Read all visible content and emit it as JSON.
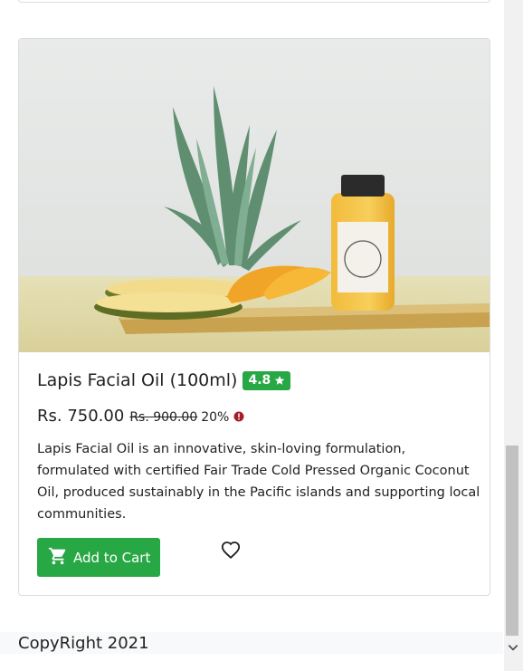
{
  "product": {
    "title": "Lapis Facial Oil (100ml)",
    "rating": "4.8",
    "price": "Rs. 750.00",
    "old_price": "Rs. 900.00",
    "discount": "20%",
    "description": "Lapis Facial Oil is an innovative, skin-loving formulation, formulated with certified Fair Trade Cold Pressed Organic Coconut Oil, produced sustainably in the Pacific islands and supporting local communities.",
    "add_to_cart_label": "Add to Cart"
  },
  "footer": {
    "copyright": "CopyRight 2021"
  },
  "icons": {
    "rating": "star-icon",
    "discount_info": "alert-circle-icon",
    "cart": "cart-icon",
    "wishlist": "heart-outline-icon",
    "scroll_down": "chevron-down-icon"
  },
  "colors": {
    "accent_green": "#28a745",
    "alert_red": "#c0392b"
  }
}
